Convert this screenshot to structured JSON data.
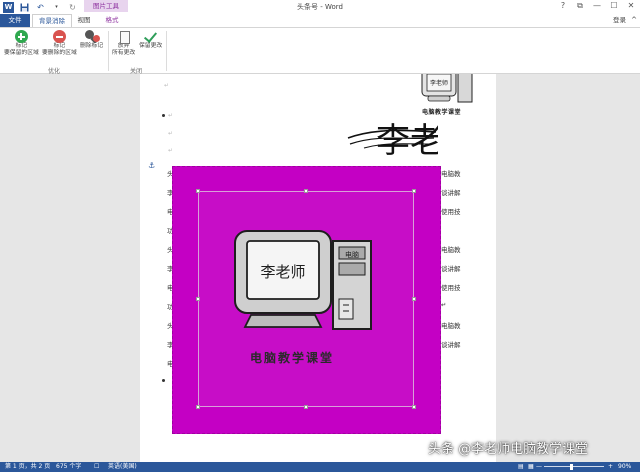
{
  "window": {
    "title": "头条号 - Word",
    "context_tab": "图片工具",
    "controls": [
      "?",
      "⧉",
      "—",
      "☐",
      "✕"
    ]
  },
  "tabs": {
    "file": "文件",
    "background_removal": "背景消除",
    "view": "视图",
    "format": "格式",
    "login": "登录"
  },
  "ribbon": {
    "mark_keep": [
      "标记",
      "要保留的区域"
    ],
    "mark_remove": [
      "标记",
      "要删除的区域"
    ],
    "delete_mark": "删除标记",
    "discard": [
      "放弃",
      "所有更改"
    ],
    "keep": "保留更改",
    "group_optimize": "优化",
    "group_close": "关闭"
  },
  "document": {
    "logo_text": "电脑教学课堂",
    "signature_text": "李老师",
    "illustration_screen_text": "李老师",
    "illustration_tower_text": "电脑",
    "illustration_caption": "电脑教学课堂",
    "left_chars": [
      "头",
      "李",
      "电",
      "功",
      "头",
      "李",
      "电",
      "功",
      "头",
      "李",
      "电"
    ],
    "right_texts": [
      "电脑教",
      "谈讲解",
      "使用技",
      "",
      "电脑教",
      "谈讲解",
      "使用技",
      "↵",
      "电脑教",
      "谈讲解",
      ""
    ]
  },
  "statusbar": {
    "pages": "第 1 页，共 2 页",
    "words": "675 个字",
    "language": "英语(美国)",
    "zoom": "90%",
    "zoom_minus": "—",
    "zoom_plus": "+"
  },
  "watermark": "头条 @李老师电脑教学课堂"
}
